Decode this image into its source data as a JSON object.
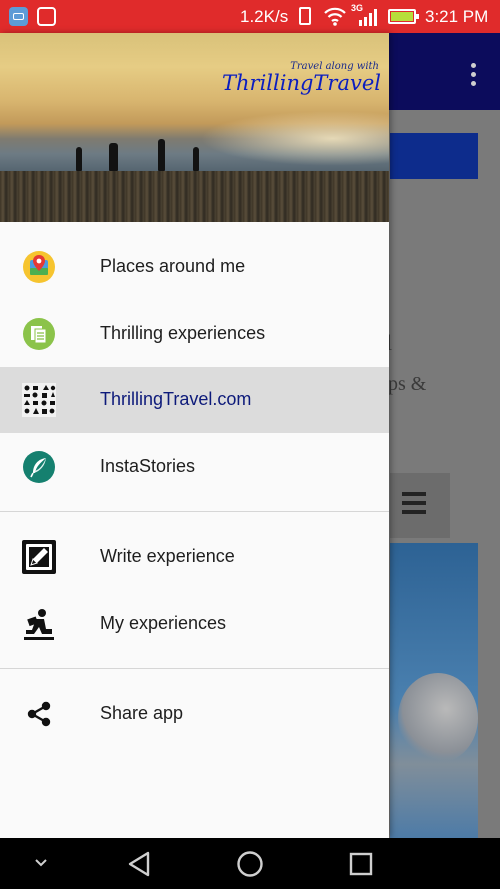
{
  "status_bar": {
    "net_speed": "1.2K/s",
    "network_type": "3G",
    "time": "3:21 PM",
    "icons": [
      "android-debug-icon",
      "usb-debug-icon",
      "vibrate-icon",
      "wifi-icon",
      "signal-icon",
      "battery-icon"
    ]
  },
  "drawer": {
    "header": {
      "tagline": "Travel along with",
      "brand": "ThrillingTravel"
    },
    "items": [
      {
        "label": "Places around me",
        "icon": "map-pin-icon"
      },
      {
        "label": "Thrilling experiences",
        "icon": "documents-icon"
      },
      {
        "label": "ThrillingTravel.com",
        "icon": "activities-grid-icon",
        "active": true
      },
      {
        "label": "InstaStories",
        "icon": "feather-icon"
      },
      {
        "label": "Write experience",
        "icon": "write-icon"
      },
      {
        "label": "My experiences",
        "icon": "reader-icon"
      },
      {
        "label": "Share app",
        "icon": "share-icon"
      }
    ]
  },
  "background_page": {
    "fragment_1": "l",
    "fragment_2": "ps &"
  },
  "colors": {
    "status_bar": "#e02b2b",
    "app_bar": "#0c0c5c",
    "active_item_bg": "#dcdcdc",
    "brand_text": "#0b1ec0"
  }
}
